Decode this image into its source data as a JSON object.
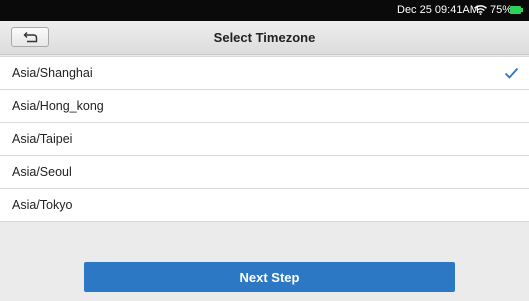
{
  "status_bar": {
    "time": "Dec 25 09:41AM",
    "battery": "75%",
    "wifi_icon": "wifi-icon",
    "battery_icon": "battery-icon",
    "battery_color": "#2fd15c"
  },
  "header": {
    "title": "Select Timezone",
    "back_icon": "back-arrow-icon"
  },
  "timezones": [
    {
      "label": "Asia/Shanghai",
      "selected": true
    },
    {
      "label": "Asia/Hong_kong",
      "selected": false
    },
    {
      "label": "Asia/Taipei",
      "selected": false
    },
    {
      "label": "Asia/Seoul",
      "selected": false
    },
    {
      "label": "Asia/Tokyo",
      "selected": false
    }
  ],
  "footer": {
    "next_label": "Next Step"
  },
  "colors": {
    "accent": "#2c78c5",
    "check": "#2c78c5"
  }
}
